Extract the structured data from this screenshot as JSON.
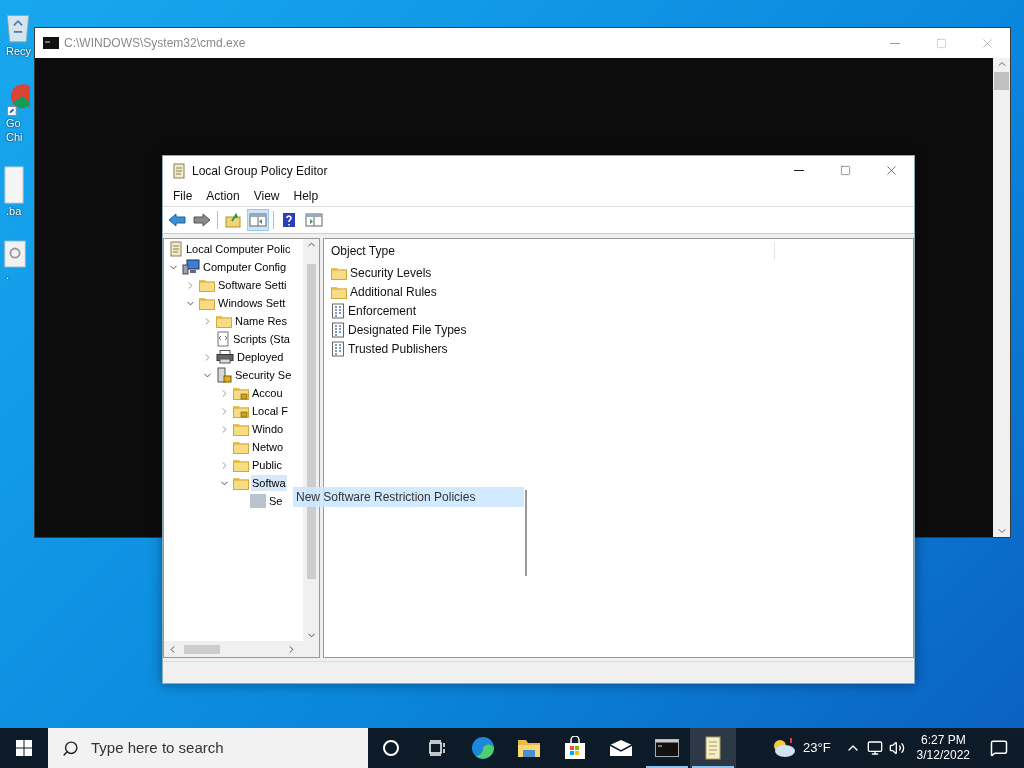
{
  "desktop_icons": [
    {
      "kind": "recycle-bin",
      "lines": [
        "Recy"
      ]
    },
    {
      "kind": "browser",
      "lines": [
        "Go",
        "Chi"
      ]
    },
    {
      "kind": "file",
      "lines": [
        ".ba"
      ]
    },
    {
      "kind": "settings",
      "lines": [
        "."
      ]
    }
  ],
  "cmd_window": {
    "title": "C:\\WINDOWS\\System32\\cmd.exe"
  },
  "gpe_window": {
    "title": "Local Group Policy Editor",
    "menu": [
      "File",
      "Action",
      "View",
      "Help"
    ],
    "toolbar": [
      {
        "kind": "back",
        "pressed": false
      },
      {
        "kind": "forward",
        "pressed": false
      },
      {
        "kind": "up",
        "pressed": false
      },
      {
        "kind": "tree-toggle",
        "pressed": true
      },
      {
        "kind": "help",
        "pressed": false
      },
      {
        "kind": "action-pane",
        "pressed": false
      }
    ],
    "tree": {
      "label": "Local Computer Polic",
      "kind": "scroll",
      "selected": false,
      "children": [
        {
          "label": "Computer Config",
          "kind": "computer",
          "expanded": true,
          "selected": false,
          "children": [
            {
              "label": "Software Setti",
              "kind": "folder",
              "expanded": false,
              "selected": false
            },
            {
              "label": "Windows Sett",
              "kind": "folder",
              "expanded": true,
              "selected": false,
              "children": [
                {
                  "label": "Name Res",
                  "kind": "folder",
                  "expanded": false,
                  "selected": false
                },
                {
                  "label": "Scripts (Sta",
                  "kind": "script",
                  "selected": false
                },
                {
                  "label": "Deployed",
                  "kind": "printer",
                  "expanded": false,
                  "selected": false
                },
                {
                  "label": "Security Se",
                  "kind": "security",
                  "expanded": true,
                  "selected": false,
                  "children": [
                    {
                      "label": "Accou",
                      "kind": "folder-lock",
                      "expanded": false,
                      "selected": false
                    },
                    {
                      "label": "Local F",
                      "kind": "folder-lock",
                      "expanded": false,
                      "selected": false
                    },
                    {
                      "label": "Windo",
                      "kind": "folder",
                      "expanded": false,
                      "selected": false
                    },
                    {
                      "label": "Netwo",
                      "kind": "folder",
                      "selected": false
                    },
                    {
                      "label": "Public",
                      "kind": "folder",
                      "expanded": false,
                      "selected": false
                    },
                    {
                      "label": "Softwa",
                      "kind": "folder",
                      "expanded": true,
                      "selected": true,
                      "children": [
                        {
                          "label": "Se",
                          "kind": "ghost",
                          "selected": false
                        }
                      ]
                    }
                  ]
                }
              ]
            }
          ]
        }
      ]
    },
    "drag_label": "New Software Restriction Policies",
    "list": {
      "column": "Object Type",
      "items": [
        {
          "label": "Security Levels",
          "kind": "folder"
        },
        {
          "label": "Additional Rules",
          "kind": "folder"
        },
        {
          "label": "Enforcement",
          "kind": "policy"
        },
        {
          "label": "Designated File Types",
          "kind": "policy"
        },
        {
          "label": "Trusted Publishers",
          "kind": "policy"
        }
      ]
    }
  },
  "taskbar": {
    "search_placeholder": "Type here to search",
    "apps": [
      {
        "kind": "cortana",
        "running": false,
        "focused": false
      },
      {
        "kind": "task-view",
        "running": false,
        "focused": false
      },
      {
        "kind": "edge",
        "running": false,
        "focused": false
      },
      {
        "kind": "explorer",
        "running": false,
        "focused": false
      },
      {
        "kind": "store",
        "running": false,
        "focused": false
      },
      {
        "kind": "mail",
        "running": false,
        "focused": false
      },
      {
        "kind": "cmd",
        "running": true,
        "focused": false
      },
      {
        "kind": "policy-editor",
        "running": true,
        "focused": true
      }
    ],
    "weather": "23°F",
    "time": "6:27 PM",
    "date": "3/12/2022"
  }
}
